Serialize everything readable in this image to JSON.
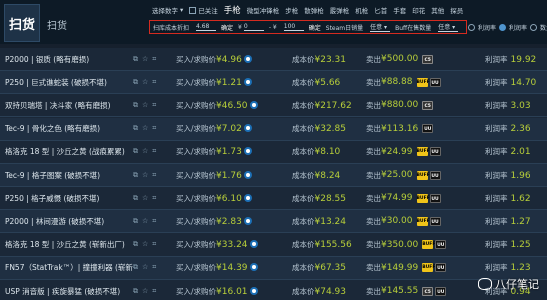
{
  "tabs": [
    {
      "label": "扫货"
    },
    {
      "label": "扫货"
    }
  ],
  "toolbar1": {
    "select_label": "选择数字",
    "select_arrow": "▾",
    "close_label": "已关注",
    "hand_label": "手枪",
    "categories": [
      "微型冲锋枪",
      "步枪",
      "散弹枪",
      "霰弹枪",
      "机枪",
      "匕首",
      "手套",
      "印花",
      "其他",
      "探员"
    ]
  },
  "toolbar2": {
    "cost_label": "扫库成本折扣",
    "cost_value": "4.68",
    "confirm_1": "确定",
    "price_label_prefix": "¥",
    "price_min": "0",
    "price_sep": "- ¥",
    "price_max": "100",
    "confirm_2": "确定",
    "steam_vol_label": "Steam日销量",
    "steam_vol_value": "任意 ▾",
    "buff_label": "Buff在售数量",
    "buff_value": "任意 ▾",
    "right_options": [
      "利润率",
      "利润率",
      "数量"
    ]
  },
  "columns": {
    "buy_prefix": "买入/求购价",
    "cost_prefix": "成本价",
    "sell_prefix": "卖出",
    "profit_prefix": "利润率"
  },
  "rows": [
    {
      "name": "P2000 | 银质 (略有磨损)",
      "buy": "¥4.96",
      "cost": "¥23.31",
      "sell": "¥500.00",
      "logos": [
        "C5"
      ],
      "profit": "19.92"
    },
    {
      "name": "P250 | 巨式谯蛇装 (破损不堪)",
      "buy": "¥1.21",
      "cost": "¥5.66",
      "sell": "¥88.88",
      "logos": [
        "BUFF",
        "UU"
      ],
      "profit": "14.70"
    },
    {
      "name": "双持贝瑞塔 | 决斗家 (略有磨损)",
      "buy": "¥46.50",
      "cost": "¥217.62",
      "sell": "¥880.00",
      "logos": [
        "C5"
      ],
      "profit": "3.03"
    },
    {
      "name": "Tec-9 | 骨化之色 (略有磨损)",
      "buy": "¥7.02",
      "cost": "¥32.85",
      "sell": "¥113.16",
      "logos": [
        "UU"
      ],
      "profit": "2.36"
    },
    {
      "name": "格洛克 18 型 | 沙丘之黄 (战痕累累)",
      "buy": "¥1.73",
      "cost": "¥8.10",
      "sell": "¥24.99",
      "logos": [
        "BUFF",
        "UU"
      ],
      "profit": "2.01"
    },
    {
      "name": "Tec-9 | 格子图案 (破损不堪)",
      "buy": "¥1.76",
      "cost": "¥8.24",
      "sell": "¥25.00",
      "logos": [
        "BUFF",
        "UU"
      ],
      "profit": "1.96"
    },
    {
      "name": "P250 | 格子威慑 (破损不堪)",
      "buy": "¥6.10",
      "cost": "¥28.55",
      "sell": "¥74.99",
      "logos": [
        "BUFF",
        "UU"
      ],
      "profit": "1.62"
    },
    {
      "name": "P2000 | 林间漫游 (破损不堪)",
      "buy": "¥2.83",
      "cost": "¥13.24",
      "sell": "¥30.00",
      "logos": [
        "BUFF",
        "UU"
      ],
      "profit": "1.27"
    },
    {
      "name": "格洛克 18 型 | 沙丘之黄 (崭新出厂)",
      "buy": "¥33.24",
      "cost": "¥155.56",
      "sell": "¥350.00",
      "logos": [
        "BUFF",
        "UU"
      ],
      "profit": "1.25"
    },
    {
      "name": "FN57（StatTrak™）| 撞撞利器 (崭新…",
      "buy": "¥14.39",
      "cost": "¥67.35",
      "sell": "¥149.99",
      "logos": [
        "BUFF",
        "UU"
      ],
      "profit": "1.23"
    },
    {
      "name": "USP 消音版 | 疾旋暴猛 (破损不堪)",
      "buy": "¥16.01",
      "cost": "¥74.93",
      "sell": "¥145.55",
      "logos": [
        "C5",
        "UU"
      ],
      "profit": "0.94"
    }
  ],
  "watermark": {
    "text": "八仔笔记"
  }
}
